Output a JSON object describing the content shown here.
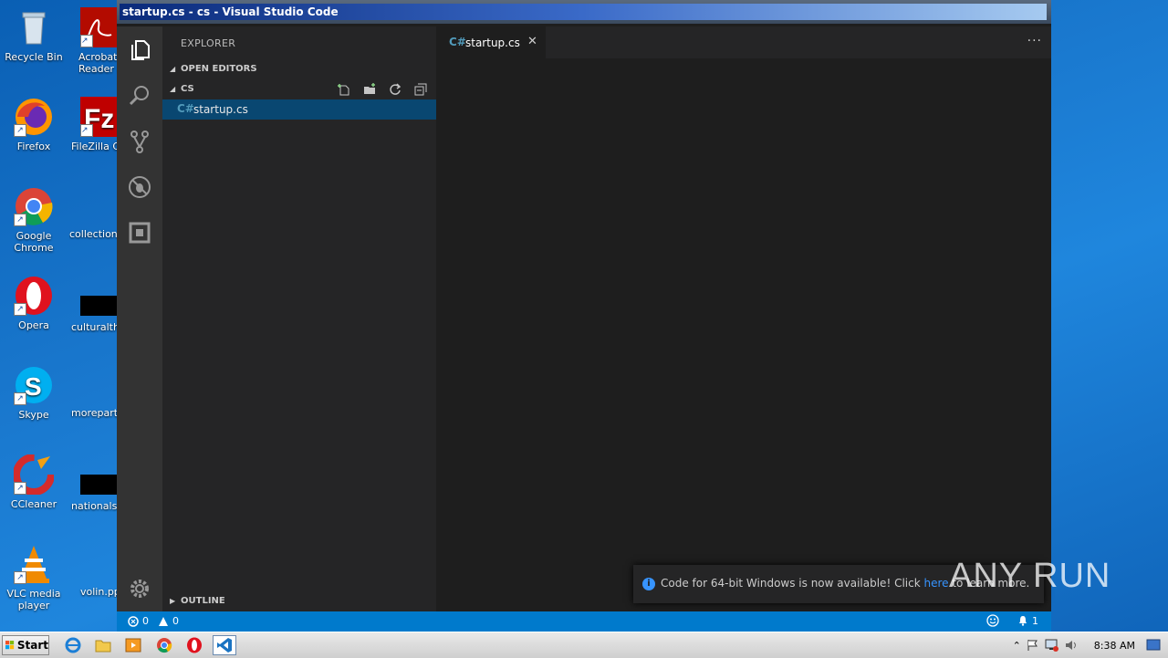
{
  "desktop": {
    "icons": [
      {
        "label": "Recycle Bin"
      },
      {
        "label": "Acrobat Reader DC"
      },
      {
        "label": "Firefox"
      },
      {
        "label": "FileZilla Cli"
      },
      {
        "label": "Google Chrome"
      },
      {
        "label": "collectionas"
      },
      {
        "label": "Opera"
      },
      {
        "label": "culturalthi"
      },
      {
        "label": "Skype"
      },
      {
        "label": "moreparty"
      },
      {
        "label": "CCleaner"
      },
      {
        "label": "nationalstu"
      },
      {
        "label": "VLC media player"
      },
      {
        "label": "volin.pp"
      }
    ]
  },
  "window": {
    "title": "startup.cs - cs - Visual Studio Code"
  },
  "sidebar": {
    "title": "EXPLORER",
    "open_editors": "OPEN EDITORS",
    "folder": "CS",
    "file": "startup.cs",
    "outline": "OUTLINE"
  },
  "editor": {
    "tab_label": "startup.cs",
    "more": "···"
  },
  "notification": {
    "text_before": "Code for 64-bit Windows is now available! Click ",
    "link": "here",
    "text_after": " to learn more."
  },
  "statusbar": {
    "errors": "0",
    "warnings": "0",
    "notifications": "1"
  },
  "watermark": "ANY RUN",
  "taskbar": {
    "start": "Start",
    "clock": "8:38 AM"
  },
  "colors": {
    "accent": "#007acc",
    "selection": "#094771",
    "link": "#3794ff"
  }
}
